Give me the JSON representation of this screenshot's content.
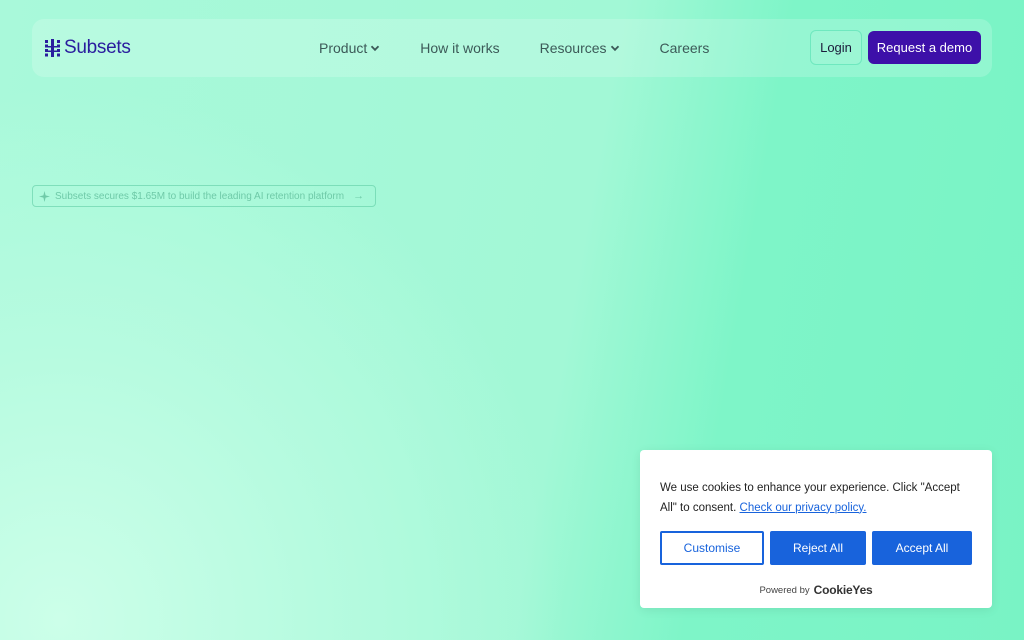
{
  "header": {
    "logo_text": "Subsets",
    "nav": [
      {
        "label": "Product",
        "has_dropdown": true
      },
      {
        "label": "How it works",
        "has_dropdown": false
      },
      {
        "label": "Resources",
        "has_dropdown": true
      },
      {
        "label": "Careers",
        "has_dropdown": false
      }
    ],
    "login_label": "Login",
    "demo_label": "Request a demo"
  },
  "announcement": {
    "text": "Subsets secures $1.65M to build the leading AI retention platform",
    "arrow": "→"
  },
  "cookie_banner": {
    "message": "We use cookies to enhance your experience. Click \"Accept All\" to consent.",
    "policy_link": "Check our privacy policy.",
    "customise_label": "Customise",
    "reject_label": "Reject All",
    "accept_label": "Accept All",
    "powered_by": "Powered by",
    "brand": "CookieYes"
  },
  "colors": {
    "brand_purple": "#3d10a9",
    "logo_blue": "#2a1d9e",
    "cookie_blue": "#1863dc",
    "mint_background": "#9ef7d3"
  },
  "icons": {
    "logo": "subsets-grid-logo",
    "dropdown": "chevron-down-icon",
    "announcement": "sparkle-icon"
  }
}
